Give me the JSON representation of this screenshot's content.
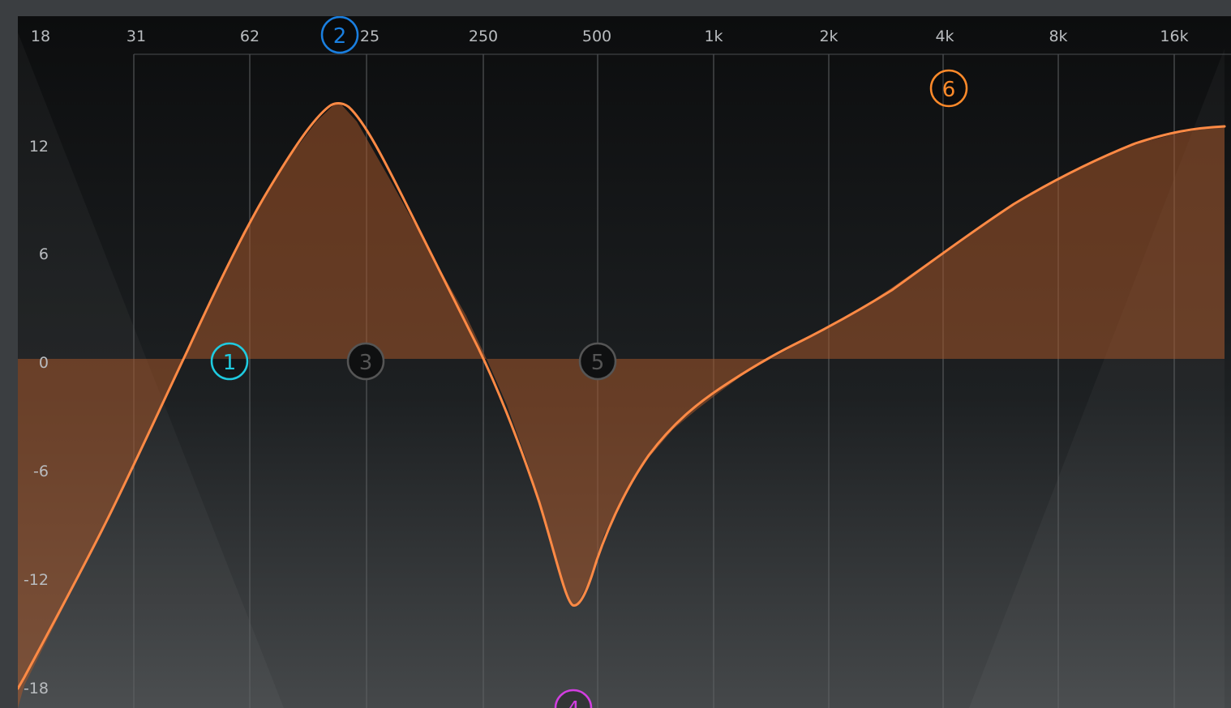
{
  "colors": {
    "curve": "#ff8a45",
    "band_fill": "#a4552a",
    "band1": "#1fcbe0",
    "band2": "#1a7fe0",
    "band3": "#555555",
    "band4": "#d23ee0",
    "band5": "#555555",
    "band6": "#ff8a2a",
    "grid": "#5f6264",
    "label": "#b9bcbf"
  },
  "frequency_axis": {
    "labels": [
      "18",
      "31",
      "62",
      "25",
      "250",
      "500",
      "1k",
      "2k",
      "4k",
      "8k",
      "16k"
    ]
  },
  "gain_axis": {
    "labels": [
      "12",
      "6",
      "0",
      "-6",
      "-12",
      "-18"
    ]
  },
  "bands": [
    {
      "id": "1",
      "state": "active"
    },
    {
      "id": "2",
      "state": "active"
    },
    {
      "id": "3",
      "state": "inactive"
    },
    {
      "id": "4",
      "state": "active"
    },
    {
      "id": "5",
      "state": "inactive"
    },
    {
      "id": "6",
      "state": "active"
    }
  ]
}
